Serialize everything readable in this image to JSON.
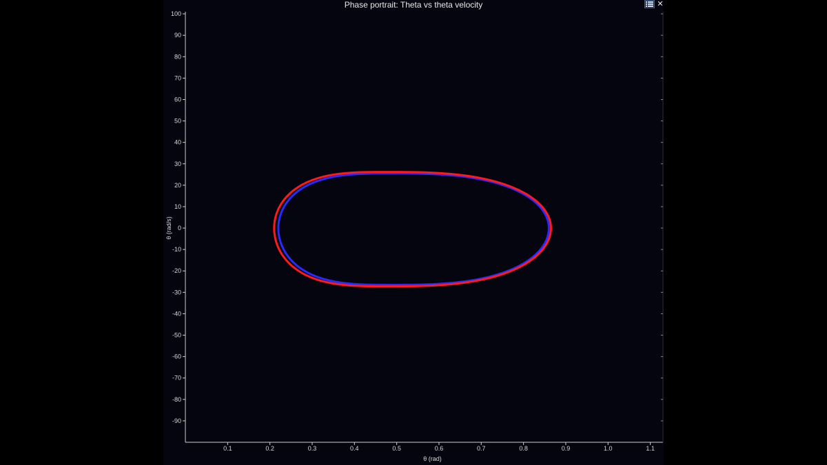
{
  "window": {
    "title": "Phase portrait: Theta vs theta velocity",
    "menu_icon": "grid-menu-icon",
    "close_icon": "close-icon",
    "close_glyph": "✕"
  },
  "chart_data": {
    "type": "line",
    "title": "Phase portrait: Theta vs theta velocity",
    "xlabel": "θ (rad)",
    "ylabel": "θ (rad/s)",
    "xlim": [
      0.0,
      1.13
    ],
    "ylim": [
      -100,
      101
    ],
    "x_ticks": [
      0.1,
      0.2,
      0.3,
      0.4,
      0.5,
      0.6,
      0.7,
      0.8,
      0.9,
      1.0,
      1.1
    ],
    "x_tick_labels": [
      "0.1",
      "0.2",
      "0.3",
      "0.4",
      "0.5",
      "0.6",
      "0.7",
      "0.8",
      "0.9",
      "1.0",
      "1.1"
    ],
    "y_ticks": [
      100,
      90,
      80,
      70,
      60,
      50,
      40,
      30,
      20,
      10,
      0,
      -10,
      -20,
      -30,
      -40,
      -50,
      -60,
      -70,
      -80,
      -90
    ],
    "y_tick_labels": [
      "100",
      "90",
      "80",
      "70",
      "60",
      "50",
      "40",
      "30",
      "20",
      "10",
      "0",
      "-10",
      "-20",
      "-30",
      "-40",
      "-50",
      "-60",
      "-70",
      "-80",
      "-90"
    ],
    "grid": false,
    "background": "#05050f",
    "axis_color": "#cfcfcf",
    "series": [
      {
        "color": "#2a2aff",
        "theta_min": 0.22,
        "theta_max": 0.86,
        "theta_at_peak": 0.49,
        "omega_max": 25.5,
        "omega_min": -26.5,
        "stroke": 3
      },
      {
        "color": "#ff1a1a",
        "theta_min": 0.21,
        "theta_max": 0.865,
        "theta_at_peak": 0.48,
        "omega_max": 26.2,
        "omega_min": -27.2,
        "stroke": 3
      }
    ]
  }
}
